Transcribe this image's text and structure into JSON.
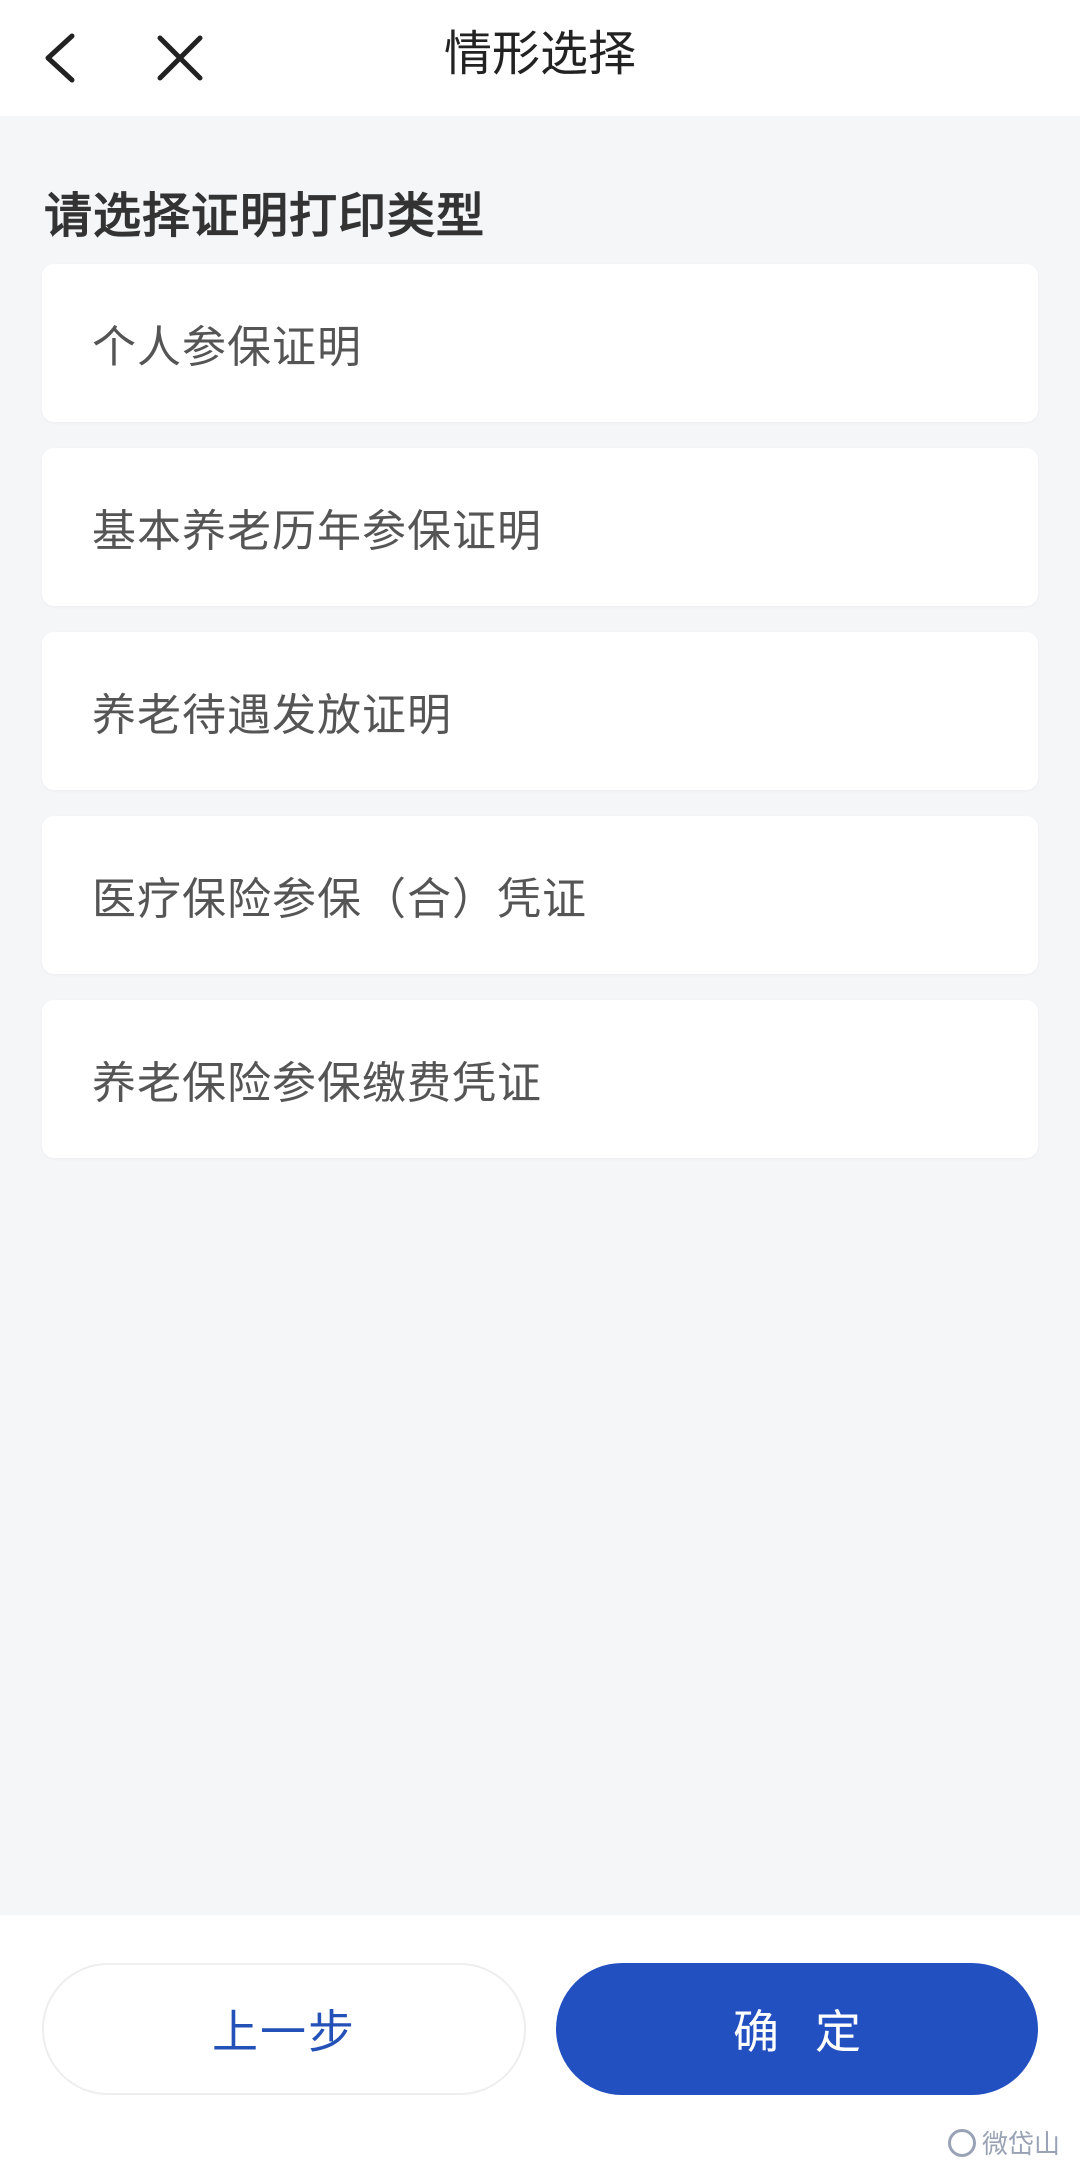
{
  "header": {
    "title": "情形选择",
    "back_icon": "chevron-left-icon",
    "close_icon": "close-icon"
  },
  "main": {
    "section_title": "请选择证明打印类型",
    "options": [
      {
        "label": "个人参保证明"
      },
      {
        "label": "基本养老历年参保证明"
      },
      {
        "label": "养老待遇发放证明"
      },
      {
        "label": "医疗保险参保（合）凭证"
      },
      {
        "label": "养老保险参保缴费凭证"
      }
    ]
  },
  "footer": {
    "prev_label": "上一步",
    "confirm_label": "确定"
  },
  "watermark": {
    "text": "微岱山"
  },
  "colors": {
    "primary": "#2350c0",
    "background": "#f5f6f8",
    "card": "#ffffff"
  }
}
